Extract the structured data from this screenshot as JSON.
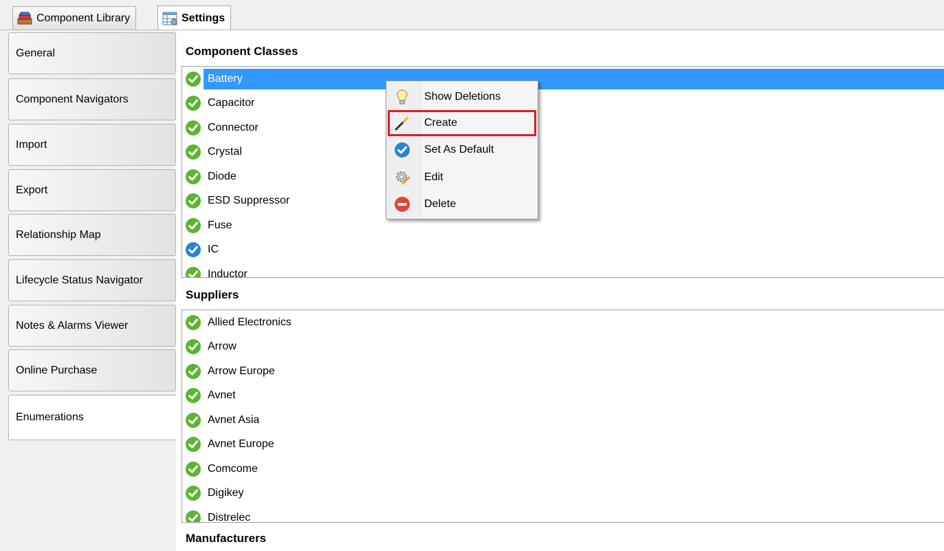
{
  "top_tabs": [
    {
      "label": "Component Library",
      "icon": "component-library-icon",
      "active": false
    },
    {
      "label": "Settings",
      "icon": "settings-table-icon",
      "active": true
    }
  ],
  "side_tabs": [
    {
      "label": "General"
    },
    {
      "label": "Component Navigators"
    },
    {
      "label": "Import"
    },
    {
      "label": "Export"
    },
    {
      "label": "Relationship Map"
    },
    {
      "label": "Lifecycle Status Navigator"
    },
    {
      "label": "Notes & Alarms Viewer"
    },
    {
      "label": "Online Purchase"
    },
    {
      "label": "Enumerations",
      "active": true
    }
  ],
  "sections": {
    "component_classes": {
      "title": "Component Classes",
      "items": [
        {
          "label": "Battery",
          "status": "check-green",
          "selected": true
        },
        {
          "label": "Capacitor",
          "status": "check-green"
        },
        {
          "label": "Connector",
          "status": "check-green"
        },
        {
          "label": "Crystal",
          "status": "check-green"
        },
        {
          "label": "Diode",
          "status": "check-green"
        },
        {
          "label": "ESD Suppressor",
          "status": "check-green"
        },
        {
          "label": "Fuse",
          "status": "check-green"
        },
        {
          "label": "IC",
          "status": "check-blue"
        },
        {
          "label": "Inductor",
          "status": "check-green"
        }
      ]
    },
    "suppliers": {
      "title": "Suppliers",
      "items": [
        {
          "label": "Allied Electronics",
          "status": "check-green"
        },
        {
          "label": "Arrow",
          "status": "check-green"
        },
        {
          "label": "Arrow Europe",
          "status": "check-green"
        },
        {
          "label": "Avnet",
          "status": "check-green"
        },
        {
          "label": "Avnet Asia",
          "status": "check-green"
        },
        {
          "label": "Avnet Europe",
          "status": "check-green"
        },
        {
          "label": "Comcome",
          "status": "check-green"
        },
        {
          "label": "Digikey",
          "status": "check-green"
        },
        {
          "label": "Distrelec",
          "status": "check-green"
        }
      ]
    },
    "manufacturers": {
      "title": "Manufacturers"
    }
  },
  "context_menu": {
    "items": [
      {
        "label": "Show Deletions",
        "icon": "lightbulb-icon"
      },
      {
        "label": "Create",
        "icon": "magic-wand-icon",
        "highlighted": true
      },
      {
        "label": "Set As Default",
        "icon": "blue-check-icon"
      },
      {
        "label": "Edit",
        "icon": "gear-pencil-icon"
      },
      {
        "label": "Delete",
        "icon": "red-minus-icon"
      }
    ]
  },
  "colors": {
    "selection": "#3399ff",
    "check_green": "#5cb531",
    "check_blue": "#2a83d4",
    "highlight_outline": "#e01b24"
  }
}
